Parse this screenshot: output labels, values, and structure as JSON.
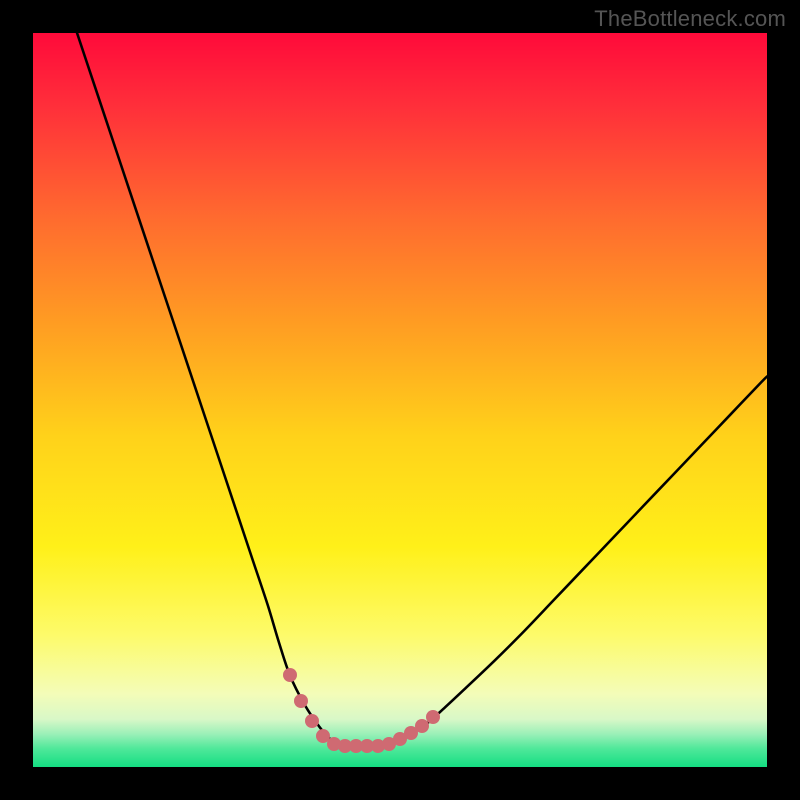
{
  "watermark": "TheBottleneck.com",
  "colors": {
    "marker": "#cf6a72",
    "curve": "#000000",
    "frame": "#000000",
    "gradient_stops": [
      {
        "offset": 0.0,
        "color": "#ff0a3a"
      },
      {
        "offset": 0.1,
        "color": "#ff2f3a"
      },
      {
        "offset": 0.25,
        "color": "#ff6a2f"
      },
      {
        "offset": 0.4,
        "color": "#ff9e22"
      },
      {
        "offset": 0.55,
        "color": "#ffd21a"
      },
      {
        "offset": 0.7,
        "color": "#fff019"
      },
      {
        "offset": 0.82,
        "color": "#fdfb6a"
      },
      {
        "offset": 0.9,
        "color": "#f4fcb8"
      },
      {
        "offset": 0.935,
        "color": "#d8f8c7"
      },
      {
        "offset": 0.955,
        "color": "#9bf0b8"
      },
      {
        "offset": 0.975,
        "color": "#4fe89a"
      },
      {
        "offset": 1.0,
        "color": "#14de82"
      }
    ]
  },
  "chart_data": {
    "type": "line",
    "title": "",
    "xlabel": "",
    "ylabel": "",
    "xlim": [
      0,
      100
    ],
    "ylim": [
      0,
      100
    ],
    "legend": false,
    "grid": false,
    "series": [
      {
        "name": "bottleneck-curve",
        "x": [
          6,
          8,
          10,
          12,
          14,
          16,
          18,
          20,
          22,
          24,
          26,
          28,
          30,
          32,
          33.5,
          35,
          37,
          39,
          40.5,
          42,
          43.5,
          45,
          47,
          49,
          51,
          53.5,
          56,
          59,
          63,
          67,
          71,
          75,
          79,
          83,
          87,
          91,
          95,
          99,
          100
        ],
        "y": [
          100,
          94,
          88,
          82,
          76,
          70,
          64,
          58,
          52,
          46,
          40,
          34,
          28,
          22,
          17,
          12.5,
          8.5,
          5.5,
          3.8,
          3.0,
          2.8,
          2.8,
          2.9,
          3.3,
          4.2,
          5.8,
          8.0,
          10.8,
          14.6,
          18.6,
          22.8,
          27.0,
          31.2,
          35.4,
          39.6,
          43.8,
          48.0,
          52.2,
          53.2
        ]
      }
    ],
    "markers": {
      "name": "valley-markers",
      "color": "#cf6a72",
      "points": [
        {
          "x": 35.0,
          "y": 12.5
        },
        {
          "x": 36.5,
          "y": 9.0
        },
        {
          "x": 38.0,
          "y": 6.2
        },
        {
          "x": 39.5,
          "y": 4.2
        },
        {
          "x": 41.0,
          "y": 3.2
        },
        {
          "x": 42.5,
          "y": 2.8
        },
        {
          "x": 44.0,
          "y": 2.8
        },
        {
          "x": 45.5,
          "y": 2.8
        },
        {
          "x": 47.0,
          "y": 2.9
        },
        {
          "x": 48.5,
          "y": 3.2
        },
        {
          "x": 50.0,
          "y": 3.8
        },
        {
          "x": 51.5,
          "y": 4.6
        },
        {
          "x": 53.0,
          "y": 5.6
        },
        {
          "x": 54.5,
          "y": 6.8
        }
      ]
    }
  }
}
